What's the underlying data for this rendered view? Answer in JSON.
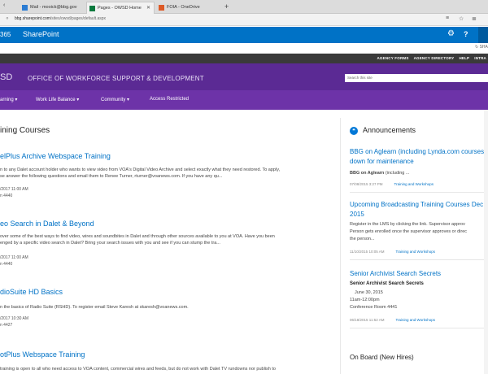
{
  "browser": {
    "tabs": [
      {
        "label": "Mail - mooick@bbg.gov"
      },
      {
        "label": "Pages - OWSD Home"
      },
      {
        "label": "FOIA - OneDrive"
      }
    ],
    "new_tab": "+",
    "url_domain": "bbg.sharepoint.com",
    "url_path": "/sites/owsd/pages/default.aspx"
  },
  "suite": {
    "app_prefix": "365",
    "app_name": "SharePoint",
    "help": "?"
  },
  "share": {
    "label": "SHA"
  },
  "agency_links": [
    "AGENCY FORMS",
    "AGENCY DIRECTORY",
    "HELP",
    "INTRA"
  ],
  "header": {
    "abbr": "SD",
    "office_name": "OFFICE OF WORKFORCE SUPPORT & DEVELOPMENT",
    "search_placeholder": "Search this site"
  },
  "nav": [
    {
      "label": "arning ▾"
    },
    {
      "label": "Work Life Balance ▾"
    },
    {
      "label": "Community ▾"
    },
    {
      "label": "Access Restricted"
    }
  ],
  "main": {
    "section_title": "ining Courses",
    "courses": [
      {
        "title": "elPlus Archive Webspace Training",
        "desc_lines": [
          "n to any Dalet account holder who wants to view video from VOA's Digital Video Archive and select exactly what they need restored. To apply,",
          "se answer the following questions and email them to Renee Turner, rturner@voanews.com. If you have any qu..."
        ],
        "meta": [
          "/2017 11:00 AM",
          "n 4440"
        ]
      },
      {
        "title": "eo Search in Dalet & Beyond",
        "desc_lines": [
          "over some of the best ways to find video, wires and soundbites in Dalet and through other sources available to you at VOA. Have you been",
          "enged by a specific video search in Dalet? Bring your search issues with you and see if you can stump the tra..."
        ],
        "meta": [
          "/2017 11:00 AM",
          "n 4440"
        ]
      },
      {
        "title": "dioSuite HD Basics",
        "desc_lines": [
          "n the basics of Radio Suite (RSHD). To register email Steve Karesh at skaresh@voanews.com."
        ],
        "meta": [
          "/2017 10:30 AM",
          "n 4427"
        ]
      },
      {
        "title": "otPlus Webspace Training",
        "desc_lines": [
          "training is open to all who need access to VOA content, commercial wires and feeds, but do not work with Dalet TV rundowns nor publish to"
        ],
        "meta": []
      }
    ]
  },
  "announcements": {
    "title": "Announcements",
    "items": [
      {
        "headline": "BBG on Aglearn (including Lynda.com courses",
        "headline2": "down for maintenance",
        "sub": "BBG on Aglearn",
        "text": [
          "(including ..."
        ],
        "date": "07/08/2015 3:27 PM",
        "category": "Training and Workshops"
      },
      {
        "headline": "Upcoming Broadcasting Training Courses Dec",
        "headline2": "2015",
        "text": [
          "Register in the LMS by clicking the link.  Supervisor approv",
          "Person gets enrolled once the supervisor approves or direc",
          "the person..."
        ],
        "date": "11/10/2015 10:05 AM",
        "category": "Training and Workshops"
      },
      {
        "headline": "Senior Archivist Search Secrets",
        "sub": "Senior Archivist Search Secrets",
        "text": [
          "June 30, 2015",
          "11am-12:00pm",
          "Conference Room 4441"
        ],
        "date": "06/18/2015 11:52 AM",
        "category": "Training and Workshops"
      }
    ],
    "next_section": "On Board (New Hires)"
  },
  "colors": {
    "suite_blue": "#0072c6",
    "header_purple": "#5b2a94",
    "nav_purple": "#6d33a8",
    "link_blue": "#0072c6",
    "agency_bar": "#3a3a3a"
  },
  "icons": [
    "tab-chevron-icon",
    "mail-icon",
    "sharepoint-icon",
    "onedrive-icon",
    "reader-icon",
    "favorites-icon",
    "hub-icon",
    "gear-icon",
    "help-icon",
    "sync-icon",
    "announcement-icon"
  ]
}
